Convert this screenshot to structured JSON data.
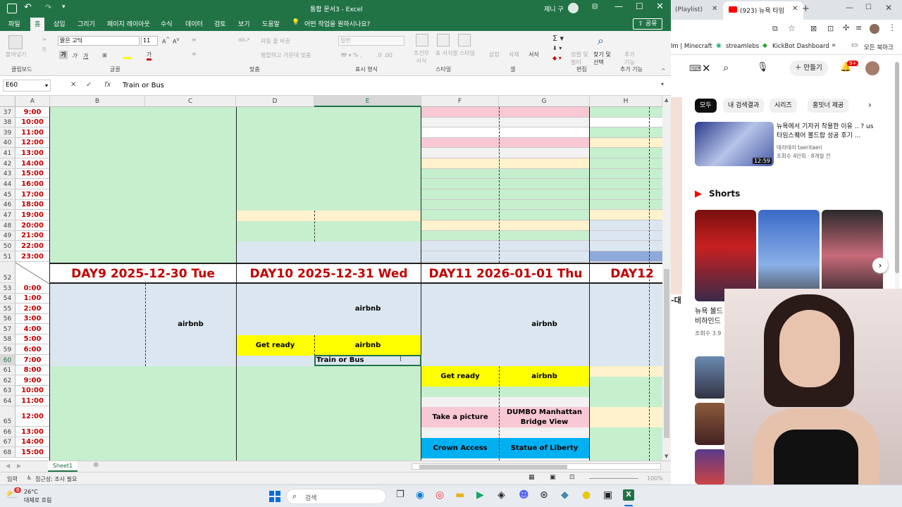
{
  "excel": {
    "title": "통합 문서3  -  Excel",
    "user": "제니 구",
    "qat_undo": "↶",
    "menu_tabs": [
      "파일",
      "홈",
      "삽입",
      "그리기",
      "페이지 레이아웃",
      "수식",
      "데이터",
      "검토",
      "보기",
      "도움말"
    ],
    "tellme": "어떤 작업을 원하시나요?",
    "share": "공유",
    "ribbon": {
      "paste": "붙여넣기",
      "font_name": "맑은 고딕",
      "font_size": "11",
      "wrap": "자동 줄 바꿈",
      "merge": "병합하고 가운데 맞춤",
      "number_format": "일반",
      "conditional": "조건부 서식",
      "table": "표 서식",
      "cellstyle": "셀 스타일",
      "insert": "삽입",
      "delete": "삭제",
      "format": "서식",
      "sort": "정렬 및 필터",
      "find": "찾기 및 선택",
      "addin": "추가 기능",
      "groups": [
        "클립보드",
        "글꼴",
        "맞춤",
        "표시 형식",
        "스타일",
        "셀",
        "편집",
        "추가 기능"
      ]
    },
    "name_box": "E60",
    "formula": "Train or Bus",
    "columns": [
      "A",
      "B",
      "C",
      "D",
      "E",
      "F",
      "G",
      "H"
    ],
    "rows_top": [
      {
        "n": "37",
        "t": "9:00"
      },
      {
        "n": "38",
        "t": "10:00"
      },
      {
        "n": "39",
        "t": "11:00"
      },
      {
        "n": "40",
        "t": "12:00"
      },
      {
        "n": "41",
        "t": "13:00"
      },
      {
        "n": "42",
        "t": "14:00"
      },
      {
        "n": "43",
        "t": "15:00"
      },
      {
        "n": "44",
        "t": "16:00"
      },
      {
        "n": "45",
        "t": "17:00"
      },
      {
        "n": "46",
        "t": "18:00"
      },
      {
        "n": "47",
        "t": "19:00"
      },
      {
        "n": "48",
        "t": "20:00"
      },
      {
        "n": "49",
        "t": "21:00"
      },
      {
        "n": "50",
        "t": "22:00"
      },
      {
        "n": "51",
        "t": "23:00"
      }
    ],
    "row52": "52",
    "days": [
      "DAY9  2025-12-30 Tue",
      "DAY10  2025-12-31 Wed",
      "DAY11  2026-01-01 Thu",
      "DAY12"
    ],
    "rows_bottom": [
      {
        "n": "53",
        "t": "0:00"
      },
      {
        "n": "54",
        "t": "1:00"
      },
      {
        "n": "55",
        "t": "2:00"
      },
      {
        "n": "56",
        "t": "3:00"
      },
      {
        "n": "57",
        "t": "4:00"
      },
      {
        "n": "58",
        "t": "5:00"
      },
      {
        "n": "59",
        "t": "6:00"
      },
      {
        "n": "60",
        "t": "7:00"
      },
      {
        "n": "61",
        "t": "8:00"
      },
      {
        "n": "62",
        "t": "9:00"
      },
      {
        "n": "63",
        "t": "10:00"
      },
      {
        "n": "64",
        "t": "11:00"
      },
      {
        "n": "65",
        "t": "12:00"
      },
      {
        "n": "66",
        "t": "13:00"
      },
      {
        "n": "67",
        "t": "14:00"
      },
      {
        "n": "68",
        "t": "15:00"
      }
    ],
    "cells": {
      "airbnb_d9": "airbnb",
      "airbnb_d10": "airbnb",
      "get_ready_d10": "Get ready",
      "airbnb_d10b": "airbnb",
      "train": "Train or Bus",
      "airbnb_d11": "airbnb",
      "get_ready_d11": "Get ready",
      "airbnb_d11b": "airbnb",
      "take_picture": "Take a picture",
      "dumbo": "DUMBO Manhattan Bridge View",
      "crown": "Crown Access",
      "liberty": "Statue of Liberty"
    },
    "sheet_tab": "Sheet1",
    "status_mode": "입력",
    "status_access": "접근성: 조사 필요",
    "zoom": "100%"
  },
  "taskbar": {
    "weather_temp": "26°C",
    "weather_desc": "대체로 흐림",
    "badge": "6",
    "search": "검색"
  },
  "chrome": {
    "tab1": "(Playlist)",
    "tab2": "(923) 뉴욕 타임",
    "bookmarks": [
      "lm | Minecraft",
      "streamlebs",
      "KickBot Dashboard"
    ],
    "bookmarks_all": "모든 북마크",
    "create": "만들기",
    "notif_badge": "9+",
    "chips": [
      "모두",
      "내 검색결과",
      "시리즈",
      "홍밋너 제공"
    ],
    "video_title": "뉴욕에서 기저귀 착용한 이유 .. ? us 타임스퀘어 볼드랍 성공 후기 ...",
    "video_channel": "테리테리 taeritaeri",
    "video_meta": "조회수 4만회 · 8개월 전",
    "video_duration": "12:59",
    "shorts": "Shorts",
    "shorts_title": "뉴욕 볼드 비하인드",
    "shorts_meta": "조회수 3.9",
    "side_text": "-대"
  }
}
